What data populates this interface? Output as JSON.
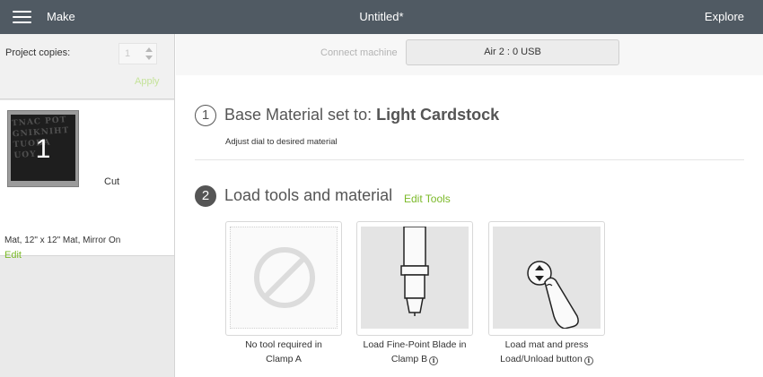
{
  "topbar": {
    "app_label": "Make",
    "doc_title": "Untitled*",
    "explore_label": "Explore"
  },
  "sidebar": {
    "copies_label": "Project copies:",
    "copies_value": "1",
    "apply_label": "Apply",
    "mat": {
      "number": "1",
      "action_label": "Cut",
      "info": "Mat, 12\" x 12\" Mat, Mirror On",
      "edit_label": "Edit",
      "art_text": "TNAC POT GNIKNIHT TUOBA UOY"
    }
  },
  "main": {
    "connect_label": "Connect machine",
    "machine_label": "Air 2 : 0 USB",
    "step1": {
      "number": "1",
      "title_prefix": "Base Material set to: ",
      "material": "Light Cardstock",
      "subtitle": "Adjust dial to desired material"
    },
    "step2": {
      "number": "2",
      "title": "Load tools and material",
      "edit_tools_label": "Edit Tools",
      "cards": [
        {
          "icon": "no-tool-icon",
          "caption_line1": "No tool required in",
          "caption_line2": "Clamp A"
        },
        {
          "icon": "fine-point-blade-icon",
          "caption_line1": "Load Fine-Point Blade in",
          "caption_line2": "Clamp B"
        },
        {
          "icon": "load-button-press-icon",
          "caption_line1": "Load mat and press",
          "caption_line2": "Load/Unload button"
        }
      ]
    }
  },
  "colors": {
    "topbar": "#505a63",
    "accent_green": "#7bb928",
    "disabled_green": "#c5e39a"
  }
}
